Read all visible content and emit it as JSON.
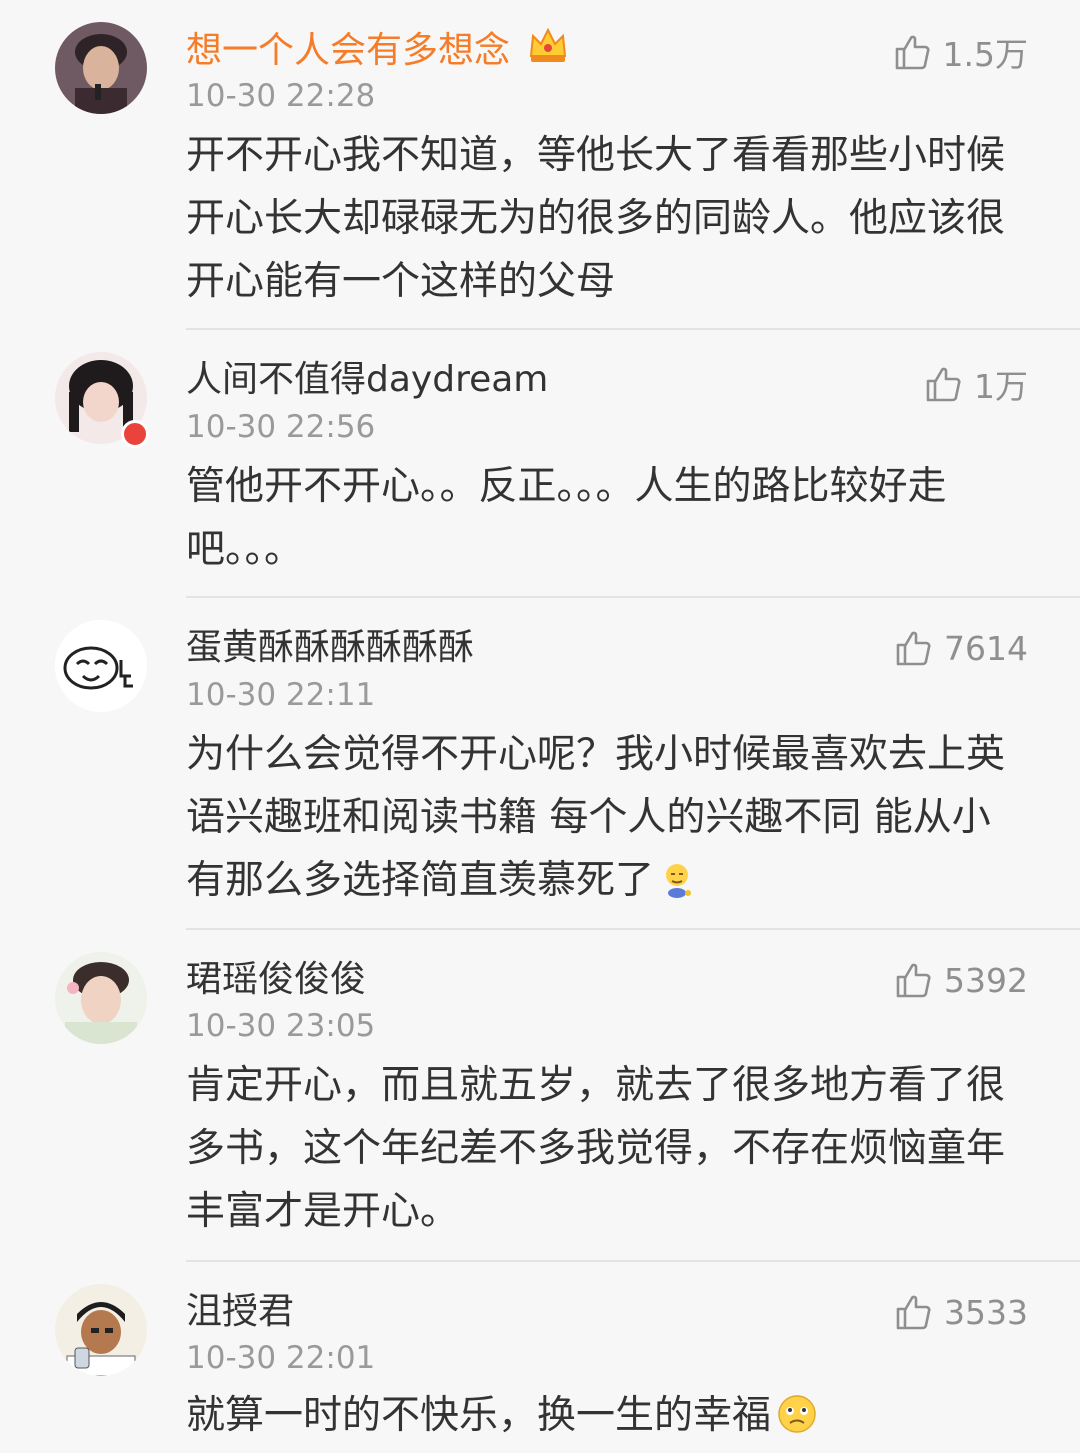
{
  "comments": [
    {
      "username": "想一个人会有多想念",
      "timestamp": "10-30 22:28",
      "likes": "1.5万",
      "body": "开不开心我不知道，等他长大了看看那些小时候开心长大却碌碌无为的很多的同龄人。他应该很开心能有一个这样的父母"
    },
    {
      "username": "人间不值得daydream",
      "timestamp": "10-30 22:56",
      "likes": "1万",
      "body": "管他开不开心。。反正。。。人生的路比较好走吧。。。"
    },
    {
      "username": "蛋黄酥酥酥酥酥酥",
      "timestamp": "10-30 22:11",
      "likes": "7614",
      "body": "为什么会觉得不开心呢？我小时候最喜欢去上英语兴趣班和阅读书籍 每个人的兴趣不同 能从小有那么多选择简直羡慕死了"
    },
    {
      "username": "珺瑶俊俊俊",
      "timestamp": "10-30 23:05",
      "likes": "5392",
      "body": "肯定开心，而且就五岁，就去了很多地方看了很多书，这个年纪差不多我觉得，不存在烦恼童年丰富才是开心。"
    },
    {
      "username": "沮授君",
      "timestamp": "10-30 22:01",
      "likes": "3533",
      "body": "就算一时的不快乐，换一生的幸福"
    }
  ],
  "icons": {
    "like": "thumbs-up-icon",
    "crown": "crown-icon",
    "emoji_sleepy": "sleepy-emoji-icon",
    "emoji_worried": "worried-emoji-icon"
  },
  "colors": {
    "vip_name": "#f57c28",
    "name": "#333333",
    "meta": "#9a9a9a",
    "background": "#f7f7f7",
    "divider": "#e3e3e3"
  }
}
